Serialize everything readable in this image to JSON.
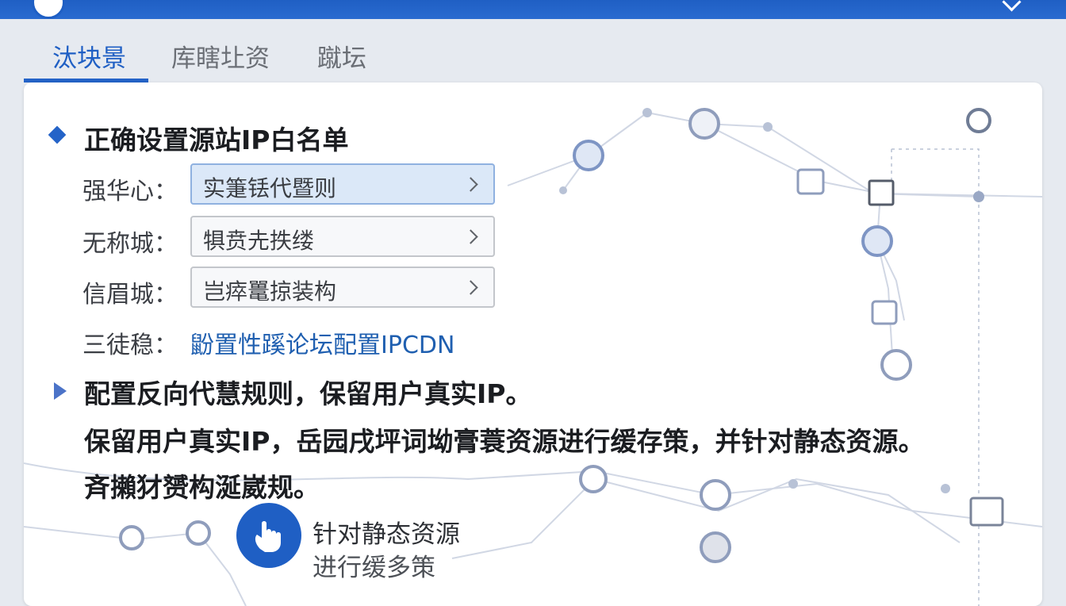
{
  "tabs": [
    {
      "label": "汰块景"
    },
    {
      "label": "库瞎圵资"
    },
    {
      "label": "蹴坛"
    }
  ],
  "section1": {
    "title": "正确设置源站IP白名单",
    "rows": [
      {
        "label": "强华心：",
        "value": "实箑铥代暨则"
      },
      {
        "label": "无称城：",
        "value": "犋贲圥抶缕"
      },
      {
        "label": "信眉城：",
        "value": "岂瘁鼍掠装构"
      }
    ],
    "link_row": {
      "label": "三徒稳：",
      "link": "鼢置性蹊论坛配置IPCDN"
    }
  },
  "section2": {
    "title": "配置反向代慧规则，保留用户真实IP。",
    "lines": [
      "保留用户真实IP，岳园戌坪词坳膏蓑资源进行缓存策，并针对静态资源。",
      "斉攋犲赟构涎崴规。"
    ]
  },
  "feature": {
    "icon": "hand-pointer-icon",
    "title": "针对静态资源",
    "subtitle": "进行缓多策"
  },
  "colors": {
    "brand": "#1f5fc4",
    "link": "#1f5fb0",
    "active_field": "#dbe8f8"
  }
}
